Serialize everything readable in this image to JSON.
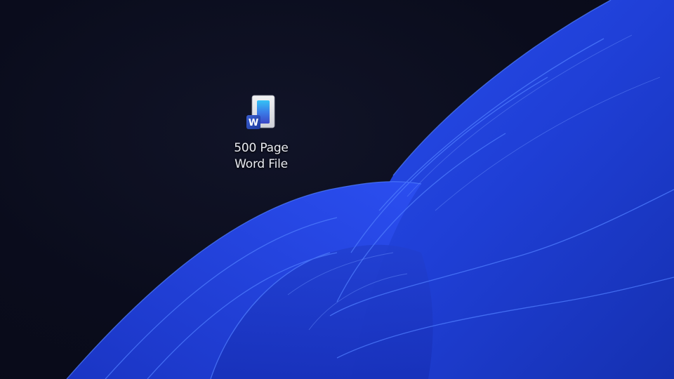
{
  "desktop": {
    "icons": [
      {
        "label_line1": "500 Page",
        "label_line2": "Word File",
        "icon": "word-document-icon"
      }
    ]
  },
  "colors": {
    "background": "#0a0c1c",
    "wallpaper_primary": "#1f3fd8",
    "wallpaper_dark": "#1328a8",
    "wallpaper_highlight": "#3f6bff",
    "word_blue": "#2b4fb8"
  }
}
